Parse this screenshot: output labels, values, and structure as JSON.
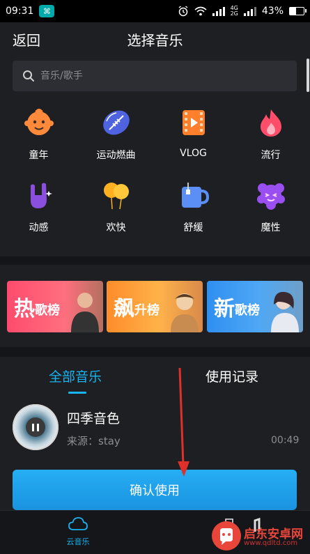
{
  "status": {
    "time": "09:31",
    "battery": "43%",
    "network": "4G\n2G",
    "battery_level": 0.43
  },
  "header": {
    "back": "返回",
    "title": "选择音乐"
  },
  "search": {
    "placeholder": "音乐/歌手"
  },
  "categories": [
    {
      "label": "童年",
      "icon": "child-face-icon"
    },
    {
      "label": "运动燃曲",
      "icon": "football-icon"
    },
    {
      "label": "VLOG",
      "icon": "film-icon"
    },
    {
      "label": "流行",
      "icon": "flame-icon"
    },
    {
      "label": "动感",
      "icon": "rock-hand-icon"
    },
    {
      "label": "欢快",
      "icon": "balloons-icon"
    },
    {
      "label": "舒缓",
      "icon": "mug-icon"
    },
    {
      "label": "魔性",
      "icon": "monster-icon"
    }
  ],
  "charts": [
    {
      "big": "热",
      "small": "歌榜",
      "color": "#ff4b6e"
    },
    {
      "big": "飙",
      "small": "升榜",
      "color": "#ff9a3a"
    },
    {
      "big": "新",
      "small": "歌榜",
      "color": "#2f8ff0"
    }
  ],
  "tabs": {
    "all": "全部音乐",
    "records": "使用记录"
  },
  "song": {
    "title": "四季音色",
    "source": "来源：stay",
    "duration": "00:49"
  },
  "confirm": {
    "label": "确认使用"
  },
  "nav": {
    "cloud": "云音乐"
  },
  "watermark": {
    "name": "启东安卓网",
    "url": "www.qdltd.com"
  }
}
